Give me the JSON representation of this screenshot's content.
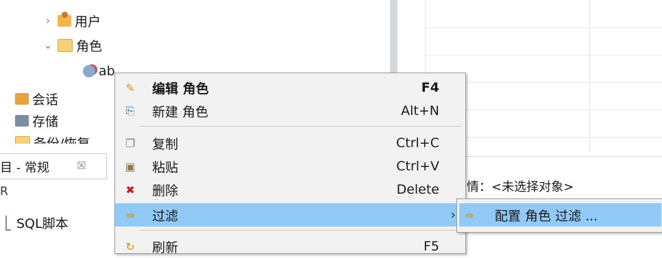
{
  "tree": {
    "items": [
      {
        "label": "用户",
        "chevron": "›",
        "icon": "users-icon"
      },
      {
        "label": "角色",
        "chevron": "⌄",
        "icon": "folder-icon"
      },
      {
        "label": "ab",
        "icon": "role-icon"
      },
      {
        "label": "会话",
        "icon": "session-icon"
      },
      {
        "label": "存储",
        "icon": "storage-icon"
      },
      {
        "label": "备份/恢复",
        "icon": "backup-icon"
      }
    ]
  },
  "bottom_panel": {
    "tab_label": "目 - 常规",
    "tab_close": "☒",
    "row1_label": "R",
    "sql_script_label": "SQL脚本",
    "details_label": "详情：<未选择对象>"
  },
  "context_menu": {
    "items": [
      {
        "label": "编辑 角色",
        "shortcut": "F4",
        "icon": "edit-icon"
      },
      {
        "label": "新建 角色",
        "shortcut": "Alt+N",
        "icon": "new-icon"
      },
      {
        "label": "复制",
        "shortcut": "Ctrl+C",
        "icon": "copy-icon"
      },
      {
        "label": "粘贴",
        "shortcut": "Ctrl+V",
        "icon": "paste-icon"
      },
      {
        "label": "删除",
        "shortcut": "Delete",
        "icon": "delete-icon"
      },
      {
        "label": "过滤",
        "arrow": "›",
        "icon": "filter-icon"
      },
      {
        "label": "刷新",
        "shortcut": "F5",
        "icon": "refresh-icon"
      }
    ],
    "submenu": {
      "label": "配置 角色 过滤 ...",
      "icon": "filter-icon"
    }
  }
}
